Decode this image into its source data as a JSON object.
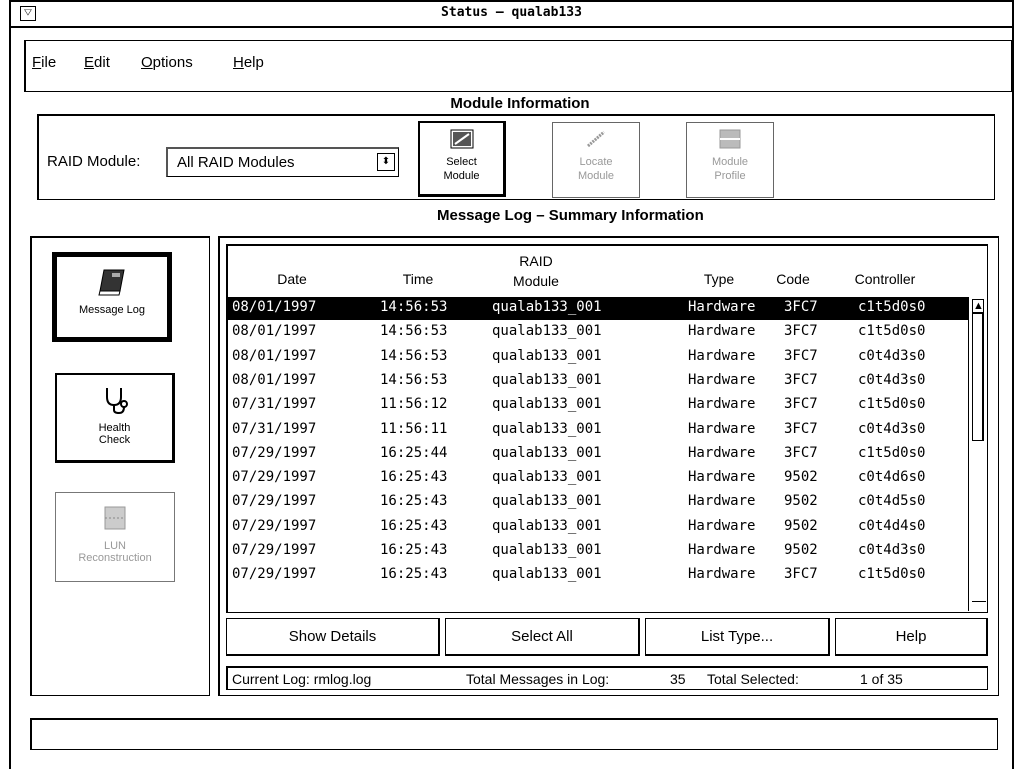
{
  "window": {
    "title": "Status – qualab133",
    "sysmenu_glyph": "▽"
  },
  "menu": [
    {
      "label": "File",
      "accel": "F",
      "rest": "ile"
    },
    {
      "label": "Edit",
      "accel": "E",
      "rest": "dit"
    },
    {
      "label": "Options",
      "accel": "O",
      "rest": "ptions"
    },
    {
      "label": "Help",
      "accel": "H",
      "rest": "elp"
    }
  ],
  "module_info": {
    "heading": "Module Information",
    "raid_label": "RAID Module:",
    "raid_value": "All RAID Modules",
    "dropdown_glyph": "⬍",
    "tools": [
      {
        "line1": "Select",
        "line2": "Module",
        "enabled": true,
        "icon": "select-module-icon"
      },
      {
        "line1": "Locate",
        "line2": "Module",
        "enabled": false,
        "icon": "locate-module-icon"
      },
      {
        "line1": "Module",
        "line2": "Profile",
        "enabled": false,
        "icon": "module-profile-icon"
      }
    ]
  },
  "log": {
    "heading": "Message Log – Summary Information",
    "columns": {
      "date": "Date",
      "time": "Time",
      "raid1": "RAID",
      "raid2": "Module",
      "type": "Type",
      "code": "Code",
      "controller": "Controller"
    },
    "rows": [
      [
        "08/01/1997",
        "14:56:53",
        "qualab133_001",
        "Hardware",
        "3FC7",
        "c1t5d0s0"
      ],
      [
        "08/01/1997",
        "14:56:53",
        "qualab133_001",
        "Hardware",
        "3FC7",
        "c1t5d0s0"
      ],
      [
        "08/01/1997",
        "14:56:53",
        "qualab133_001",
        "Hardware",
        "3FC7",
        "c0t4d3s0"
      ],
      [
        "08/01/1997",
        "14:56:53",
        "qualab133_001",
        "Hardware",
        "3FC7",
        "c0t4d3s0"
      ],
      [
        "07/31/1997",
        "11:56:12",
        "qualab133_001",
        "Hardware",
        "3FC7",
        "c1t5d0s0"
      ],
      [
        "07/31/1997",
        "11:56:11",
        "qualab133_001",
        "Hardware",
        "3FC7",
        "c0t4d3s0"
      ],
      [
        "07/29/1997",
        "16:25:44",
        "qualab133_001",
        "Hardware",
        "3FC7",
        "c1t5d0s0"
      ],
      [
        "07/29/1997",
        "16:25:43",
        "qualab133_001",
        "Hardware",
        "9502",
        "c0t4d6s0"
      ],
      [
        "07/29/1997",
        "16:25:43",
        "qualab133_001",
        "Hardware",
        "9502",
        "c0t4d5s0"
      ],
      [
        "07/29/1997",
        "16:25:43",
        "qualab133_001",
        "Hardware",
        "9502",
        "c0t4d4s0"
      ],
      [
        "07/29/1997",
        "16:25:43",
        "qualab133_001",
        "Hardware",
        "9502",
        "c0t4d3s0"
      ],
      [
        "07/29/1997",
        "16:25:43",
        "qualab133_001",
        "Hardware",
        "3FC7",
        "c1t5d0s0"
      ]
    ],
    "selected_row": 0,
    "actions": [
      "Show Details",
      "Select All",
      "List Type...",
      "Help"
    ],
    "status": {
      "current_log": "Current Log: rmlog.log",
      "total_label": "Total Messages in Log:",
      "total_value": "35",
      "selected_label": "Total Selected:",
      "selected_value": "1 of  35"
    }
  },
  "left_panel": [
    {
      "line1": "Message Log",
      "line2": "",
      "state": "active",
      "icon": "message-log-icon"
    },
    {
      "line1": "Health",
      "line2": "Check",
      "state": "normal",
      "icon": "stethoscope-icon"
    },
    {
      "line1": "LUN",
      "line2": "Reconstruction",
      "state": "disabled",
      "icon": "lun-reconstruction-icon"
    }
  ],
  "scroll_up_glyph": "▲"
}
